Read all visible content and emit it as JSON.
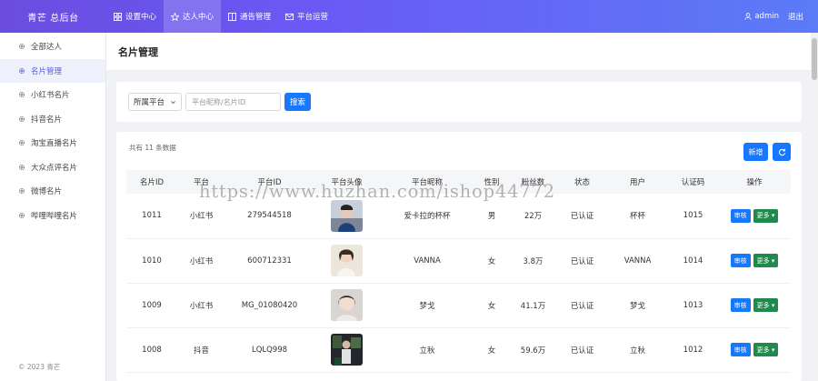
{
  "brand": "青芒 总后台",
  "nav": [
    {
      "label": "设置中心",
      "icon": "grid-icon"
    },
    {
      "label": "达人中心",
      "icon": "star-icon"
    },
    {
      "label": "通告管理",
      "icon": "columns-icon"
    },
    {
      "label": "平台运营",
      "icon": "mail-icon"
    }
  ],
  "user": {
    "name": "admin",
    "logout": "退出"
  },
  "sidebar": {
    "items": [
      {
        "label": "全部达人"
      },
      {
        "label": "名片管理"
      },
      {
        "label": "小红书名片"
      },
      {
        "label": "抖音名片"
      },
      {
        "label": "淘宝直播名片"
      },
      {
        "label": "大众点评名片"
      },
      {
        "label": "微博名片"
      },
      {
        "label": "哔哩哔哩名片"
      }
    ],
    "copyright": "© 2023 青芒"
  },
  "page": {
    "title": "名片管理"
  },
  "filter": {
    "platform_select": "所属平台",
    "search_placeholder": "平台昵称/名片ID",
    "search_button": "搜索"
  },
  "table": {
    "total": "共有 11 条数据",
    "new_button": "新增",
    "columns": [
      "名片ID",
      "平台",
      "平台ID",
      "平台头像",
      "平台昵称",
      "性别",
      "粉丝数",
      "状态",
      "用户",
      "认证码",
      "操作"
    ],
    "rows": [
      {
        "id": "1011",
        "platform": "小红书",
        "platform_id": "279544518",
        "nickname": "爱卡拉的杯杯",
        "gender": "男",
        "fans": "22万",
        "status": "已认证",
        "user": "杯杯",
        "code": "1015",
        "audit": "审核",
        "more": "更多"
      },
      {
        "id": "1010",
        "platform": "小红书",
        "platform_id": "600712331",
        "nickname": "VANNA",
        "gender": "女",
        "fans": "3.8万",
        "status": "已认证",
        "user": "VANNA",
        "code": "1014",
        "audit": "审核",
        "more": "更多"
      },
      {
        "id": "1009",
        "platform": "小红书",
        "platform_id": "MG_01080420",
        "nickname": "梦戈",
        "gender": "女",
        "fans": "41.1万",
        "status": "已认证",
        "user": "梦戈",
        "code": "1013",
        "audit": "审核",
        "more": "更多"
      },
      {
        "id": "1008",
        "platform": "抖音",
        "platform_id": "LQLQ998",
        "nickname": "立秋",
        "gender": "女",
        "fans": "59.6万",
        "status": "已认证",
        "user": "立秋",
        "code": "1012",
        "audit": "审核",
        "more": "更多"
      }
    ]
  },
  "watermark": "https://www.huzhan.com/ishop44772",
  "colors": {
    "accent": "#1677ff",
    "more": "#1f8a4c",
    "topbar": "#6a5af5"
  }
}
